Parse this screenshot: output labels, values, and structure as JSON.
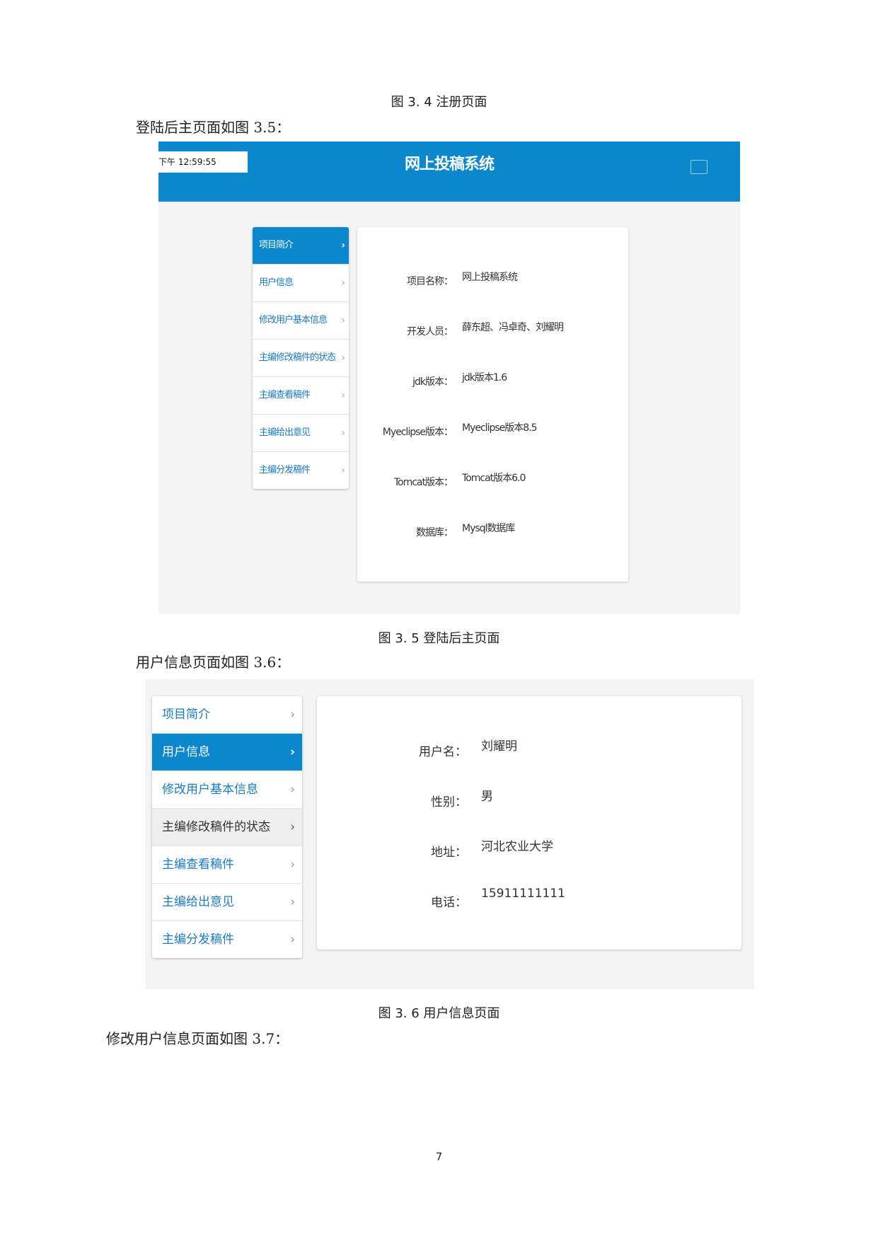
{
  "fig34_caption": "图 3. 4 注册页面",
  "para_35": "登陆后主页面如图 3.5：",
  "fig35": {
    "clock": "下午 12:59:55",
    "title": "网上投稿系统",
    "menu": [
      "项目简介",
      "用户信息",
      "修改用户基本信息",
      "主编修改稿件的状态",
      "主编查看稿件",
      "主编给出意见",
      "主编分发稿件"
    ],
    "rows": [
      {
        "key": "项目名称：",
        "value": "网上投稿系统"
      },
      {
        "key": "开发人员：",
        "value": "薛东超、冯卓奇、刘耀明"
      },
      {
        "key": "jdk版本：",
        "value": "jdk版本1.6"
      },
      {
        "key": "Myeclipse版本：",
        "value": "Myeclipse版本8.5"
      },
      {
        "key": "Tomcat版本：",
        "value": "Tomcat版本6.0"
      },
      {
        "key": "数据库：",
        "value": "Mysql数据库"
      }
    ]
  },
  "fig35_caption": "图 3. 5 登陆后主页面",
  "para_36": "用户信息页面如图 3.6：",
  "fig36": {
    "menu": [
      "项目简介",
      "用户信息",
      "修改用户基本信息",
      "主编修改稿件的状态",
      "主编查看稿件",
      "主编给出意见",
      "主编分发稿件"
    ],
    "rows": [
      {
        "key": "用户名：",
        "value": "刘耀明"
      },
      {
        "key": "性别：",
        "value": "男"
      },
      {
        "key": "地址：",
        "value": "河北农业大学"
      },
      {
        "key": "电话：",
        "value": "15911111111"
      }
    ]
  },
  "fig36_caption": "图 3. 6 用户信息页面",
  "para_37": "修改用户信息页面如图 3.7：",
  "page_number": "7",
  "colors": {
    "accent": "#0a87cd",
    "link": "#1a7bc7",
    "background": "#f4f4f4"
  },
  "icons": {
    "menu_chevron": "chevron-right-icon",
    "logout": "logout-icon"
  }
}
